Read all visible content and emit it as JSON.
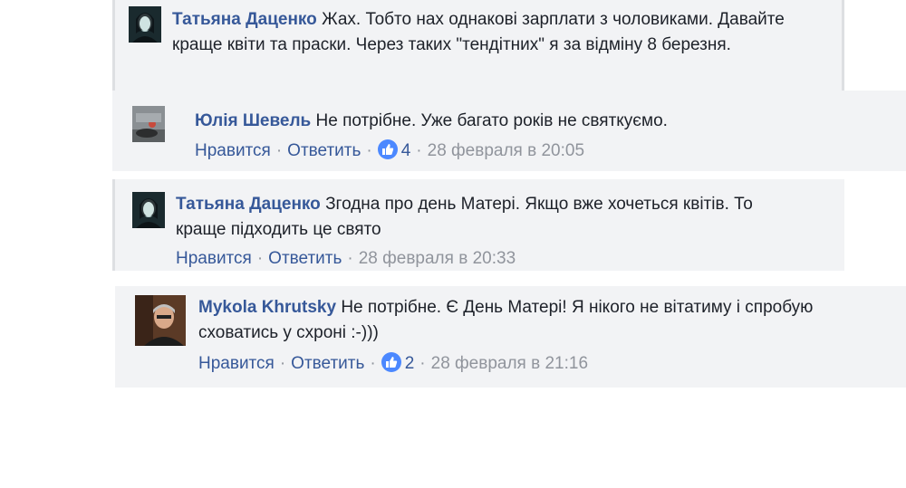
{
  "like_label": "Нравится",
  "reply_label": "Ответить",
  "comments": [
    {
      "author": "Татьяна Даценко",
      "text": "Жах. Тобто нах однакові зарплати з чоловиками. Давайте краще квіти та праски. Через таких \"тендітних\" я за відміну 8 березня."
    },
    {
      "author": "Юлія Шевель",
      "text": "Не потрібне. Уже багато років не святкуємо.",
      "likes": "4",
      "time": "28 февраля в 20:05"
    },
    {
      "author": "Татьяна Даценко",
      "text": "Згодна про день Матері. Якщо вже хочеться квітів. То краще підходить це свято",
      "time": "28 февраля в 20:33"
    },
    {
      "author": "Mykola Khrutsky",
      "text": "Не потрібне. Є День Матері! Я нікого не вітатиму і спробую сховатись у схроні :-)))",
      "likes": "2",
      "time": "28 февраля в 21:16"
    }
  ],
  "colors": {
    "link": "#365899",
    "meta": "#90949c",
    "background": "#f2f3f5",
    "like_badge": "#4b88ff"
  }
}
